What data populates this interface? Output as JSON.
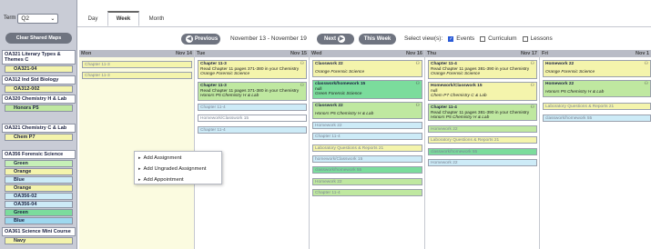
{
  "sidebar": {
    "term_label": "Term",
    "term_value": "Q2",
    "clear_button": "Clear Shared Maps",
    "groups": [
      {
        "title": "OA321 Literary Types & Themes C",
        "rows": [
          {
            "label": "OA321-04",
            "color": "#f4f4ac"
          }
        ]
      },
      {
        "title": "OA312 Ind Std Biology",
        "rows": [
          {
            "label": "OA312-002",
            "color": "#f4f4ac"
          }
        ]
      },
      {
        "title": "OA320 Chemistry H & Lab",
        "rows": [
          {
            "label": "Honors P5",
            "color": "#bfe8a0"
          }
        ]
      },
      {
        "title": "OA321 Chemistry C & Lab",
        "rows": [
          {
            "label": "Chem P7",
            "color": "#f4f4ac"
          }
        ]
      },
      {
        "title": "OA356 Forensic Science",
        "rows": [
          {
            "label": "Green",
            "color": "#c6f0b7"
          },
          {
            "label": "Orange",
            "color": "#f4f4ac"
          },
          {
            "label": "Blue",
            "color": "#cdebf7"
          },
          {
            "label": "Orange",
            "color": "#f4f4ac"
          },
          {
            "label": "OA356-02",
            "color": "#cdebf7"
          },
          {
            "label": "OA356-04",
            "color": "#cdebf7"
          },
          {
            "label": "Green",
            "color": "#7bdc9c"
          },
          {
            "label": "Blue",
            "color": "#9ed8ef"
          }
        ]
      },
      {
        "title": "OA361 Science Mini Course",
        "rows": [
          {
            "label": "Navy",
            "color": "#f4f4ac"
          }
        ]
      }
    ]
  },
  "tabs": [
    {
      "label": "Day"
    },
    {
      "label": "Week"
    },
    {
      "label": "Month"
    }
  ],
  "nav": {
    "previous": "Previous",
    "date_range": "November 13 - November 19",
    "next": "Next",
    "this_week": "This Week",
    "select_views": "Select view(s):",
    "events": "Events",
    "curriculum": "Curriculum",
    "lessons": "Lessons"
  },
  "days": [
    {
      "name": "Mon",
      "date": "Nov 14"
    },
    {
      "name": "Tue",
      "date": "Nov 15"
    },
    {
      "name": "Wed",
      "date": "Nov 16"
    },
    {
      "name": "Thu",
      "date": "Nov 17"
    },
    {
      "name": "Fri",
      "date": "Nov 1"
    }
  ],
  "events": {
    "mon": [
      {
        "title": "Chapter 11-3"
      },
      {
        "title": "Chapter 11-3"
      }
    ],
    "tue": [
      {
        "title": "Chapter 11-3",
        "desc": "Read Chapter 11 pages 371-380 in your Chemistry",
        "sub": "Orange Forensic Science"
      },
      {
        "title": "Chapter 11-3",
        "desc": "Read Chapter 11 pages 371-380 in your Chemistry",
        "sub": "Honors P5 Chemistry H & Lab"
      },
      {
        "title": "Chapter 11-4"
      },
      {
        "title": "Homework/Classwork 15"
      },
      {
        "title": "Chapter 11-4"
      }
    ],
    "wed": [
      {
        "title": "Classwork 22",
        "sub": "Orange Forensic Science"
      },
      {
        "title": "classwork/homework 15",
        "desc": "null",
        "sub": "Green Forensic Science"
      },
      {
        "title": "Classwork 22",
        "sub": "Honors P5 Chemistry H & Lab"
      },
      {
        "title": "Homework 22"
      },
      {
        "title": "Chapter 11-4"
      },
      {
        "title": "Laboratory Questions & Reports 21"
      },
      {
        "title": "homework/Classwork 15"
      },
      {
        "title": "classwork/homework 55"
      },
      {
        "title": "Homework 22"
      },
      {
        "title": "Chapter 11-4"
      }
    ],
    "thu": [
      {
        "title": "Chapter 11-4",
        "desc": "Read Chapter 11 pages 381-390 in your Chemistry",
        "sub": "Orange Forensic Science"
      },
      {
        "title": "Homework/Classwork 15",
        "desc": "null",
        "sub": "Chem P7 Chemistry C & Lab"
      },
      {
        "title": "Chapter 11-4",
        "desc": "Read Chapter 11 pages 381-390 in your Chemistry",
        "sub": "Honors P5 Chemistry H & Lab"
      },
      {
        "title": "Homework 22"
      },
      {
        "title": "Laboratory Questions & Reports 21"
      },
      {
        "title": "classwork/homework 55"
      },
      {
        "title": "Homework 22"
      }
    ],
    "fri": [
      {
        "title": "Homework 22",
        "sub": "Orange Forensic Science"
      },
      {
        "title": "Homework 22",
        "sub": "Honors P5 Chemistry H & Lab"
      },
      {
        "title": "Laboratory Questions & Reports 21"
      },
      {
        "title": "classwork/homework 55"
      }
    ]
  },
  "context_menu": {
    "items": [
      {
        "label": "Add Assignment"
      },
      {
        "label": "Add Ungraded Assignment"
      },
      {
        "label": "Add Appointment"
      }
    ]
  },
  "colors": {
    "yellow": "#f4f4ac",
    "green": "#bfe8a0",
    "mint": "#7bdc9c",
    "cyan": "#cdebf7",
    "button": "#6f7480"
  }
}
